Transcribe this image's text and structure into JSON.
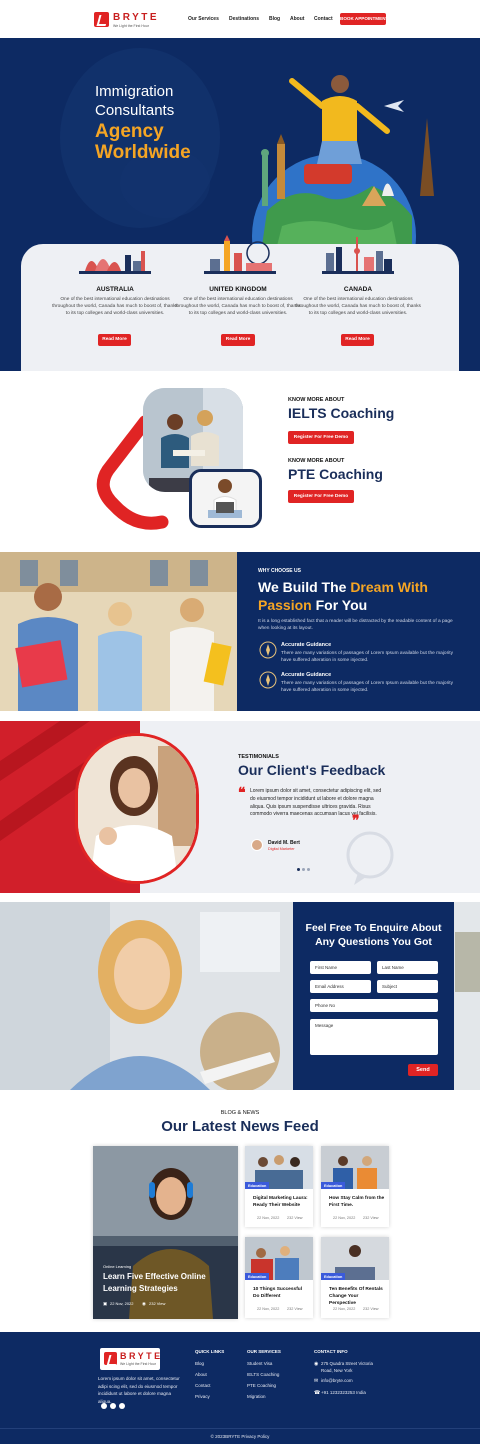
{
  "brand": {
    "name": "BRYTE",
    "tagline": "We Light the First Hour",
    "footer_tagline": "We Light the First Hour"
  },
  "nav": {
    "items": [
      "Our Services",
      "Destinations",
      "Blog",
      "About",
      "Contact"
    ],
    "cta": "BOOK APPOINTMENT"
  },
  "hero": {
    "line1": "Immigration",
    "line2": "Consultants",
    "line3": "Agency",
    "line4": "Worldwide"
  },
  "destinations": [
    {
      "name": "AUSTRALIA",
      "desc": "One of the best international education destinations throughout the world, Canada has much to boost of, thanks to its top colleges and world-class universities.",
      "button": "Read More"
    },
    {
      "name": "UNITED KINGDOM",
      "desc": "One of the best international education destinations throughout the world, Canada has much to boost of, thanks to its top colleges and world-class universities.",
      "button": "Read More"
    },
    {
      "name": "CANADA",
      "desc": "One of the best international education destinations throughout the world, Canada has much to boost of, thanks to its top colleges and world-class universities.",
      "button": "Read More"
    }
  ],
  "coaching": [
    {
      "kicker": "KNOW MORE ABOUT",
      "title": "IELTS Coaching",
      "button": "Register For Free Demo"
    },
    {
      "kicker": "KNOW MORE ABOUT",
      "title": "PTE Coaching",
      "button": "Register For Free Demo"
    }
  ],
  "why": {
    "kicker": "WHY CHOOSE US",
    "title_a": "We Build The ",
    "title_b": "Dream With",
    "title_c": "Passion",
    " title_d": "",
    "title_e": " For You",
    "intro": "It is a long established fact that a reader will be distracted by the readable content of a page when looking at its layout.",
    "features": [
      {
        "title": "Accurate Guidance",
        "text": "There are many variations of passages of Lorem Ipsum available but the majority have suffered alteration in some injected."
      },
      {
        "title": "Accurate Guidance",
        "text": "There are many variations of passages of Lorem Ipsum available but the majority have suffered alteration in some injected."
      }
    ]
  },
  "testimonials": {
    "kicker": "TESTIMONIALS",
    "title": "Our Client's Feedback",
    "quote": "Lorem ipsum dolor sit amet, consectetur adipiscing elit, sed do eiusmod tempor incididunt ut labore et dolore magna aliqua. Quis ipsum suspendisse ultrices gravida. Risus commodo viverra maecenas accumsan lacus vel facilisis.",
    "author": "David M. Bert",
    "role": "Digital Marketer"
  },
  "contact": {
    "title1": "Feel Free To Enquire About",
    "title2": "Any Questions You Got",
    "first_name": "First Name",
    "last_name": "Last Name",
    "email": "Email Address",
    "subject": "Subject",
    "phone": "Phone No",
    "message": "Message",
    "send": "Send"
  },
  "blog": {
    "kicker": "BLOG & NEWS",
    "title": "Our Latest News Feed",
    "featured": {
      "category": "Online Learning",
      "title1": "Learn Five Effective Online",
      "title2": "Learning Strategies",
      "date": "22 Nov, 2022",
      "views": "232 View"
    },
    "posts": [
      {
        "category": "Education",
        "title": "Digital Marketing Laura: Ready Their Website",
        "date": "22 Nov, 2022",
        "views": "232 View"
      },
      {
        "category": "Education",
        "title": "How Stay Calm from the First Time.",
        "date": "22 Nov, 2022",
        "views": "232 View"
      },
      {
        "category": "Education",
        "title": "10 Things Successful Do Different",
        "date": "22 Nov, 2022",
        "views": "232 View"
      },
      {
        "category": "Education",
        "title": "Ten Benefits Of Rentals Change Your Perspective",
        "date": "22 Nov, 2022",
        "views": "232 View"
      }
    ]
  },
  "footer": {
    "about": "Lorem ipsum dolor sit amet, consectetur adipi scing elit, sed do eiusmod tempor incididunt ut labore et dolore magna aliqua.",
    "quick_title": "QUICK LINKS",
    "quick": [
      "Blog",
      "About",
      "Contact",
      "Privacy"
    ],
    "services_title": "OUR SERVICES",
    "services": [
      "Student Visa",
      "IELTS Coaching",
      "PTE Coaching",
      "Migration"
    ],
    "contact_title": "CONTACT INFO",
    "address": "275 Quadra Street Victoria Road, New York",
    "email": "info@bryte.com",
    "phone": "+91 1232323253 India",
    "copyright": "© 2023BRYTE Privacy Policy"
  },
  "colors": {
    "navy": "#0d2a63",
    "red": "#e02424",
    "gold": "#f5a524",
    "panel": "#eef0f4"
  }
}
